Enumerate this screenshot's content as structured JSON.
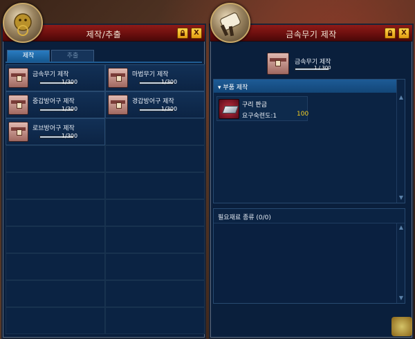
{
  "left_window": {
    "title": "제작/추출",
    "tabs": [
      {
        "label": "제작",
        "active": true
      },
      {
        "label": "추출",
        "active": false
      }
    ],
    "recipes": [
      {
        "name": "금속무기 제작",
        "count": "1/300",
        "progress": 0.0033
      },
      {
        "name": "마법무기 제작",
        "count": "1/300",
        "progress": 0.0033
      },
      {
        "name": "중갑방어구 제작",
        "count": "1/300",
        "progress": 0.0033
      },
      {
        "name": "경갑방어구 제작",
        "count": "1/300",
        "progress": 0.0033
      },
      {
        "name": "로브방어구 제작",
        "count": "1/300",
        "progress": 0.0033
      }
    ],
    "lock_icon": "lock-icon",
    "close_label": "X"
  },
  "right_window": {
    "title": "금속무기 제작",
    "selected": {
      "name": "금속무기 제작",
      "count": "1 / 300"
    },
    "parts_header": "▾ 부품 제작",
    "part": {
      "name": "구리 판금",
      "req_label": "요구숙련도:1",
      "quantity": "100"
    },
    "materials_header": "필요재료 종류 (0/0)",
    "close_label": "X"
  },
  "colors": {
    "title_red": "#8e1b18",
    "panel_blue": "#0a1f3c",
    "tab_active": "#2a7cc0",
    "qty_yellow": "#f8d020"
  }
}
